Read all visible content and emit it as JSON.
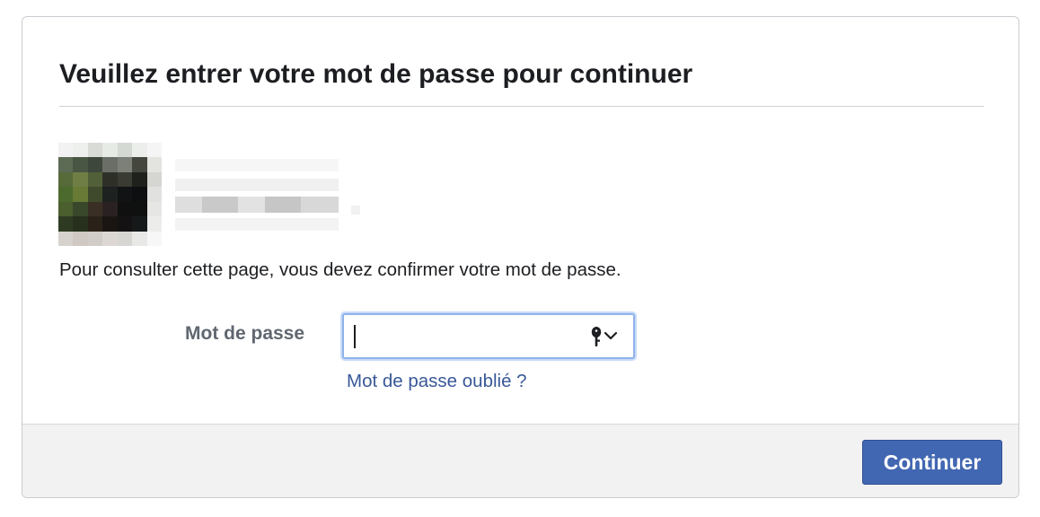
{
  "dialog": {
    "title": "Veuillez entrer votre mot de passe pour continuer",
    "instruction": "Pour consulter cette page, vous devez confirmer votre mot de passe."
  },
  "account": {
    "avatar": "blurred-profile-photo",
    "name": ""
  },
  "password": {
    "label": "Mot de passe",
    "value": "",
    "placeholder": "",
    "autofill_icon": "key-icon",
    "dropdown_icon": "chevron-down-icon"
  },
  "links": {
    "forgot_password": "Mot de passe oublié ?"
  },
  "footer": {
    "continue_label": "Continuer"
  },
  "colors": {
    "title_text": "#1c1e21",
    "label_text": "#606770",
    "link": "#385898",
    "primary_button": "#4267b2",
    "focus_ring": "#8fb3ea",
    "footer_bg": "#f2f2f2"
  }
}
